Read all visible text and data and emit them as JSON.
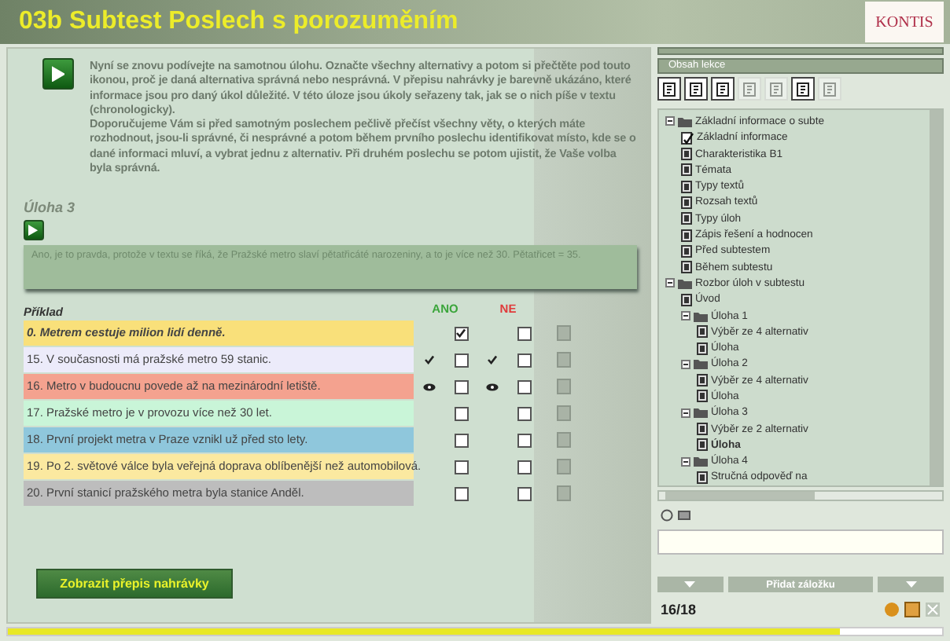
{
  "header": {
    "title": "03b Subtest Poslech s porozuměním",
    "logo": "KONTIS"
  },
  "instructions": "Nyní se znovu podívejte na samotnou úlohu. Označte všechny alternativy a potom si přečtěte pod touto ikonou, proč je daná alternativa správná nebo nesprávná. V přepisu nahrávky je barevně ukázáno, které informace jsou pro daný úkol důležité. V této úloze jsou úkoly seřazeny tak, jak se o nich píše v textu (chronologicky).\nDoporučujeme Vám si před samotným poslechem pečlivě přečíst všechny věty, o kterých máte rozhodnout, jsou-li správné, či nesprávné a potom během prvního poslechu identifikovat místo, kde se o dané informaci mluví, a vybrat jednu z alternativ. Při druhém poslechu se potom ujistit, že Vaše volba byla správná.",
  "task_title": "Úloha 3",
  "feedback": "Ano, je to pravda, protože v textu se říká, že Pražské metro slaví pětatřicáté narozeniny, a to je více než 30. Pětatřicet = 35.",
  "table": {
    "heading": "Příklad",
    "yes": "ANO",
    "no": "NE"
  },
  "rows": [
    {
      "text": "0. Metrem cestuje milion lidí denně.",
      "color": "#f9e07a",
      "example": true,
      "ano": true,
      "ne": false,
      "kind": "plain"
    },
    {
      "text": "15. V současnosti má pražské metro 59 stanic.",
      "color": "#ecebfa",
      "example": false,
      "ano": false,
      "ne": false,
      "kind": "tick"
    },
    {
      "text": "16. Metro v budoucnu povede až na mezinárodní letiště.",
      "color": "#f4a28f",
      "example": false,
      "ano": false,
      "ne": false,
      "kind": "eye"
    },
    {
      "text": "17. Pražské metro je v provozu více než 30 let.",
      "color": "#c9f5d8",
      "example": false,
      "ano": false,
      "ne": false,
      "kind": "plain"
    },
    {
      "text": "18. První projekt metra v Praze vznikl už před sto lety.",
      "color": "#8fc7dc",
      "example": false,
      "ano": false,
      "ne": false,
      "kind": "plain"
    },
    {
      "text": "19. Po 2. světové válce byla veřejná doprava oblíbenější než automobilová.",
      "color": "#fbe9a0",
      "example": false,
      "ano": false,
      "ne": false,
      "kind": "plain"
    },
    {
      "text": "20. První stanicí pražského metra byla stanice Anděl.",
      "color": "#bdbdbd",
      "example": false,
      "ano": false,
      "ne": false,
      "kind": "plain"
    }
  ],
  "transcript_button": "Zobrazit přepis nahrávky",
  "sidebar": {
    "title": "Obsah lekce",
    "toolbar": [
      {
        "disabled": false
      },
      {
        "disabled": false
      },
      {
        "disabled": false
      },
      {
        "disabled": true
      },
      {
        "disabled": true
      },
      {
        "disabled": false
      },
      {
        "disabled": true
      }
    ],
    "tree": [
      {
        "label": "Základní informace o subte",
        "kind": "folder",
        "selected": false,
        "children": [
          {
            "label": "Základní informace",
            "kind": "checked-doc",
            "selected": false
          },
          {
            "label": "Charakteristika B1",
            "kind": "doc",
            "selected": false
          },
          {
            "label": "Témata",
            "kind": "doc",
            "selected": false
          },
          {
            "label": "Typy textů",
            "kind": "doc",
            "selected": false
          },
          {
            "label": "Rozsah textů",
            "kind": "doc",
            "selected": false
          },
          {
            "label": "Typy úloh",
            "kind": "doc",
            "selected": false
          },
          {
            "label": "Zápis řešení a hodnocen",
            "kind": "doc",
            "selected": false
          },
          {
            "label": "Před subtestem",
            "kind": "doc",
            "selected": false
          },
          {
            "label": "Během subtestu",
            "kind": "doc",
            "selected": false
          }
        ]
      },
      {
        "label": "Rozbor úloh v subtestu",
        "kind": "folder",
        "selected": false,
        "children": [
          {
            "label": "Úvod",
            "kind": "doc",
            "selected": false
          },
          {
            "label": "Úloha 1",
            "kind": "folder",
            "selected": false,
            "children": [
              {
                "label": "Výběr ze 4 alternativ",
                "kind": "doc",
                "selected": false
              },
              {
                "label": "Úloha",
                "kind": "doc",
                "selected": false
              }
            ]
          },
          {
            "label": "Úloha 2",
            "kind": "folder",
            "selected": false,
            "children": [
              {
                "label": "Výběr ze 4 alternativ",
                "kind": "doc",
                "selected": false
              },
              {
                "label": "Úloha",
                "kind": "doc",
                "selected": false
              }
            ]
          },
          {
            "label": "Úloha 3",
            "kind": "folder",
            "selected": false,
            "children": [
              {
                "label": "Výběr ze 2 alternativ",
                "kind": "doc",
                "selected": false
              },
              {
                "label": "Úloha",
                "kind": "doc",
                "selected": true
              }
            ]
          },
          {
            "label": "Úloha 4",
            "kind": "folder",
            "selected": false,
            "children": [
              {
                "label": "Stručná odpověď na",
                "kind": "doc",
                "selected": false
              }
            ]
          }
        ]
      }
    ],
    "bookmark_button": "Přidat záložku",
    "page": "16/18"
  },
  "progress": {
    "level": 0.89
  }
}
